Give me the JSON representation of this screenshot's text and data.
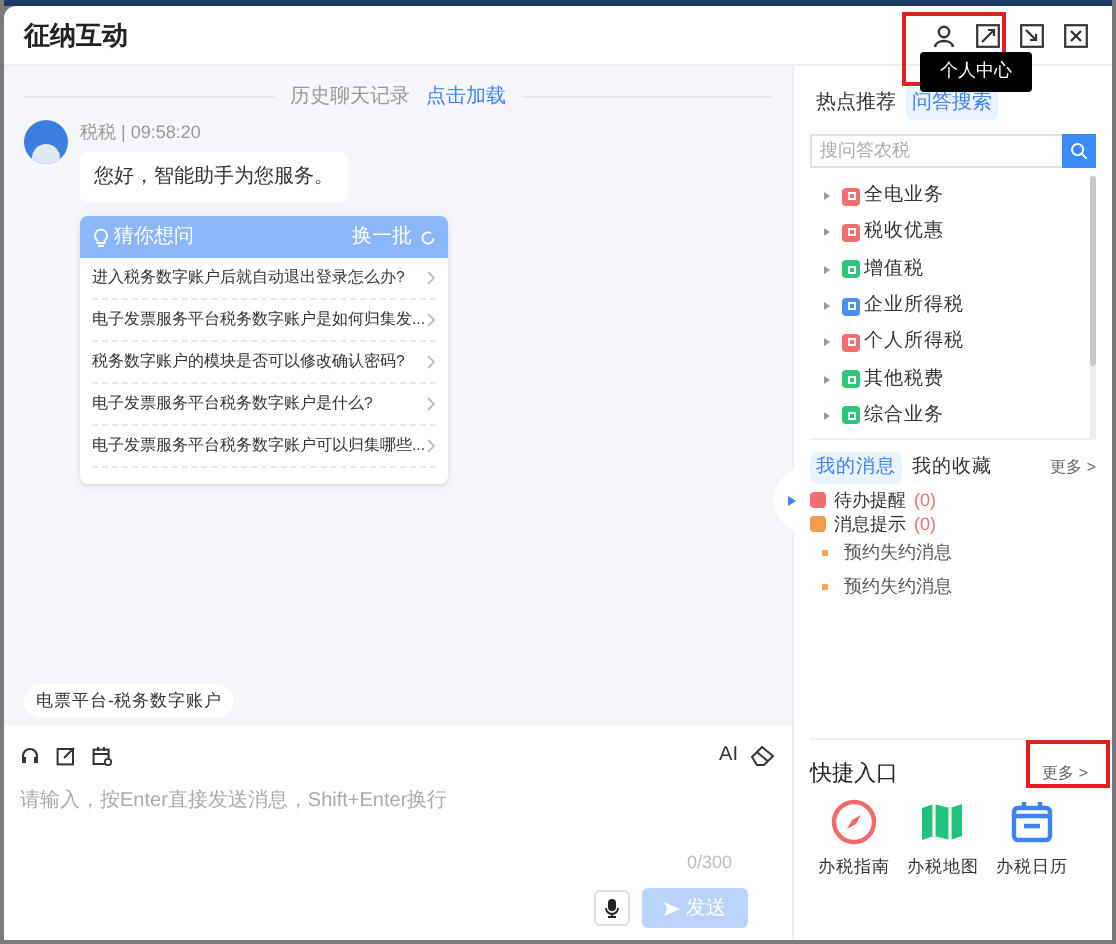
{
  "window": {
    "title": "征纳互动",
    "tooltip": "个人中心"
  },
  "chat": {
    "history_label": "历史聊天记录",
    "history_link": "点击加载",
    "sender": "税税 | 09:58:20",
    "greeting": "您好，智能助手为您服务。",
    "suggest": {
      "title": "猜你想问",
      "refresh": "换一批",
      "questions": [
        "进入税务数字账户后就自动退出登录怎么办?",
        "电子发票服务平台税务数字账户是如何归集发...",
        "税务数字账户的模块是否可以修改确认密码?",
        "电子发票服务平台税务数字账户是什么?",
        "电子发票服务平台税务数字账户可以归集哪些..."
      ]
    },
    "chip": "电票平台-税务数字账户"
  },
  "composer": {
    "ai": "AI",
    "placeholder": "请输入，按Enter直接发送消息，Shift+Enter换行",
    "counter": "0/300",
    "send": "发送",
    "send_disabled": true
  },
  "side": {
    "tabs": [
      {
        "label": "热点推荐",
        "selected": false
      },
      {
        "label": "问答搜索",
        "selected": true
      }
    ],
    "search": {
      "placeholder": "搜问答农税"
    },
    "tree": [
      {
        "label": "全电业务",
        "color": "#f07070"
      },
      {
        "label": "税收优惠",
        "color": "#f07070"
      },
      {
        "label": "增值税",
        "color": "#2cc47a"
      },
      {
        "label": "企业所得税",
        "color": "#4a8ef0"
      },
      {
        "label": "个人所得税",
        "color": "#f07070"
      },
      {
        "label": "其他税费",
        "color": "#2cc47a"
      },
      {
        "label": "综合业务",
        "color": "#2cc47a"
      }
    ],
    "msg_tabs": [
      {
        "label": "我的消息",
        "selected": true
      },
      {
        "label": "我的收藏",
        "selected": false
      }
    ],
    "msg_more": "更多 >",
    "notices": [
      {
        "label": "待办提醒",
        "count": "(0)",
        "color": "#f07070"
      },
      {
        "label": "消息提示",
        "count": "(0)",
        "color": "#f59a4a"
      }
    ],
    "messages": [
      "预约失约消息",
      "预约失约消息"
    ],
    "quick": {
      "title": "快捷入口",
      "more": "更多 >",
      "items": [
        {
          "label": "办税指南",
          "kind": "compass"
        },
        {
          "label": "办税地图",
          "kind": "map"
        },
        {
          "label": "办税日历",
          "kind": "calendar"
        }
      ]
    }
  }
}
